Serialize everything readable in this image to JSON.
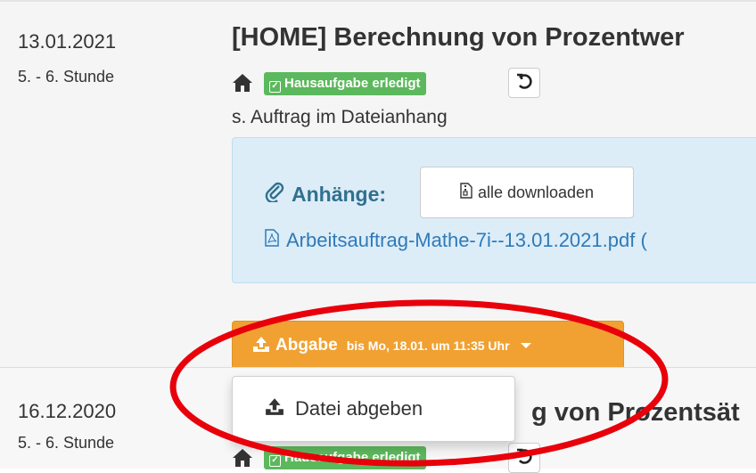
{
  "entry1": {
    "date": "13.01.2021",
    "period": "5. - 6. Stunde",
    "title": "[HOME] Berechnung von Prozentwer",
    "badge": "Hausaufgabe erledigt",
    "description": "s. Auftrag im Dateianhang",
    "attachments_label": "Anhänge:",
    "download_all": "alle downloaden",
    "file_name": "Arbeitsauftrag-Mathe-7i--13.01.2021.pdf (",
    "upload_main": "Abgabe",
    "upload_deadline": "bis Mo, 18.01. um 11:35 Uhr",
    "dropdown_item": "Datei abgeben"
  },
  "entry2": {
    "date": "16.12.2020",
    "period": "5. - 6. Stunde",
    "title": "g von Prozentsät",
    "badge": "Hausaufgabe erledigt"
  },
  "icons": [
    "home-icon",
    "check-square-icon",
    "undo-icon",
    "paperclip-icon",
    "file-archive-icon",
    "file-pdf-icon",
    "upload-icon",
    "caret-down-icon"
  ],
  "colors": {
    "badge_green": "#5cb85c",
    "upload_orange": "#f0a132",
    "info_bg": "#dcedf8",
    "info_text": "#31708f",
    "link_blue": "#2f7ab8",
    "annotation_red": "#e8000b"
  }
}
